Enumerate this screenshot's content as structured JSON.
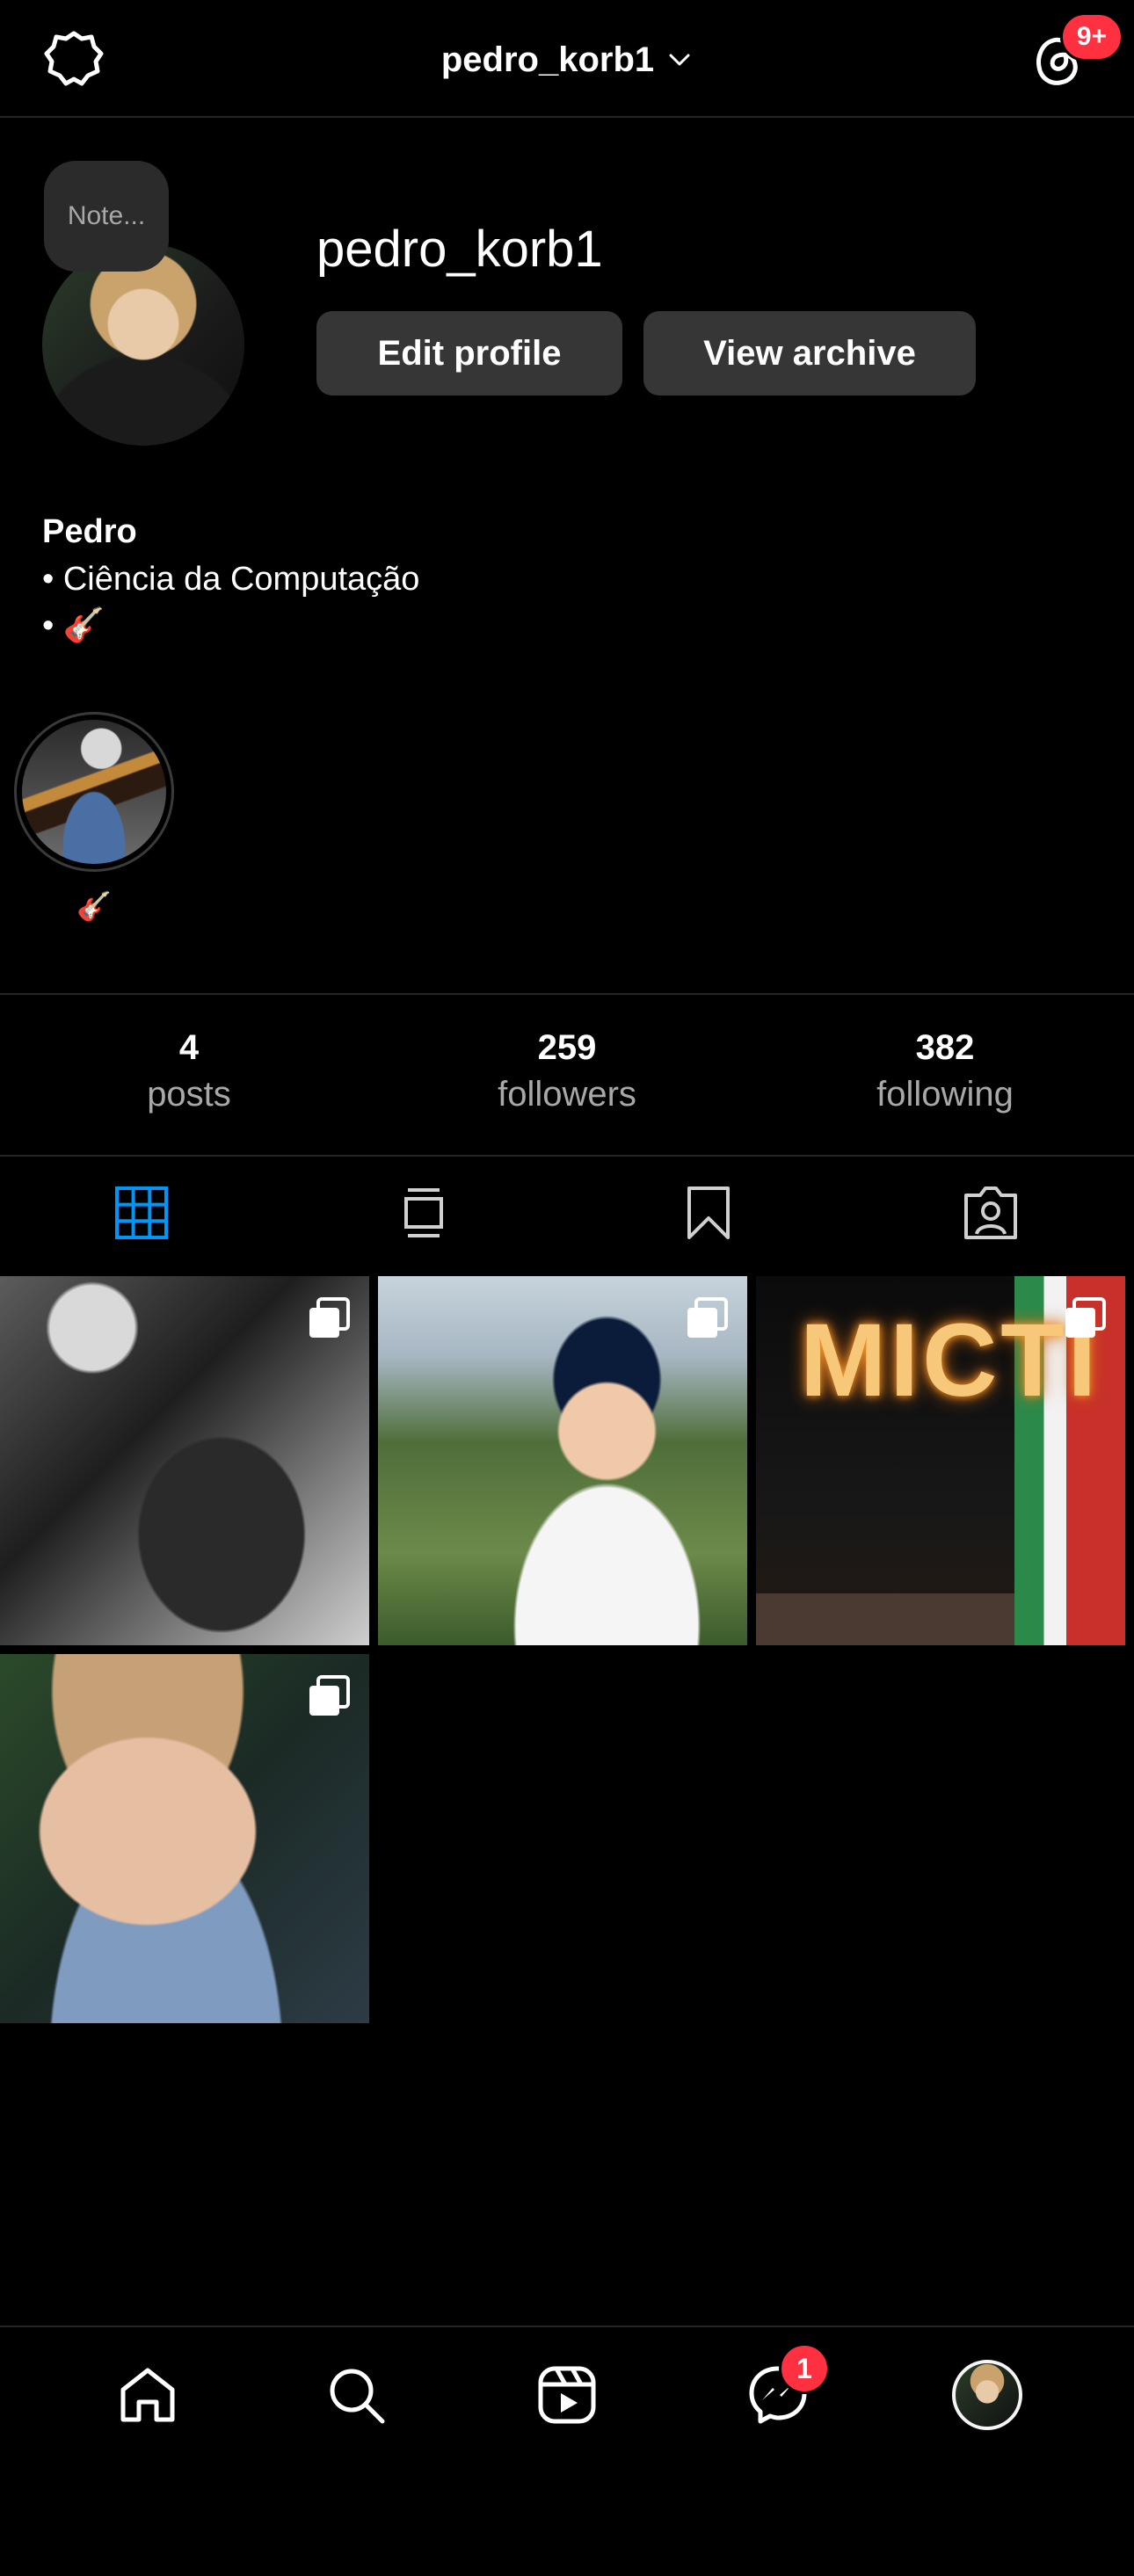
{
  "header": {
    "title": "pedro_korb1",
    "threads_badge": "9+"
  },
  "profile": {
    "note_placeholder": "Note...",
    "username": "pedro_korb1",
    "edit_profile_label": "Edit profile",
    "view_archive_label": "View archive",
    "bio_name": "Pedro",
    "bio_lines": [
      "• Ciência da Computação",
      "• 🎸"
    ]
  },
  "highlights": [
    {
      "label": "🎸"
    }
  ],
  "stats": [
    {
      "value": "4",
      "label": "posts"
    },
    {
      "value": "259",
      "label": "followers"
    },
    {
      "value": "382",
      "label": "following"
    }
  ],
  "tabs": [
    {
      "icon": "grid-icon",
      "active": true
    },
    {
      "icon": "reels-feed-icon",
      "active": false
    },
    {
      "icon": "bookmark-icon",
      "active": false
    },
    {
      "icon": "tagged-icon",
      "active": false
    }
  ],
  "posts": [
    {
      "multi": true
    },
    {
      "multi": true
    },
    {
      "multi": true,
      "sign_text": "MICTI"
    },
    {
      "multi": true
    }
  ],
  "bottom_nav": {
    "items": [
      "home-icon",
      "search-icon",
      "reels-icon",
      "messenger-icon",
      "profile-avatar"
    ],
    "messages_badge": "1"
  },
  "colors": {
    "background": "#000000",
    "text": "#f5f5f5",
    "secondary_text": "#a8a8a8",
    "button_bg": "#363636",
    "accent_blue": "#0095f6",
    "badge_red": "#ff3040"
  }
}
